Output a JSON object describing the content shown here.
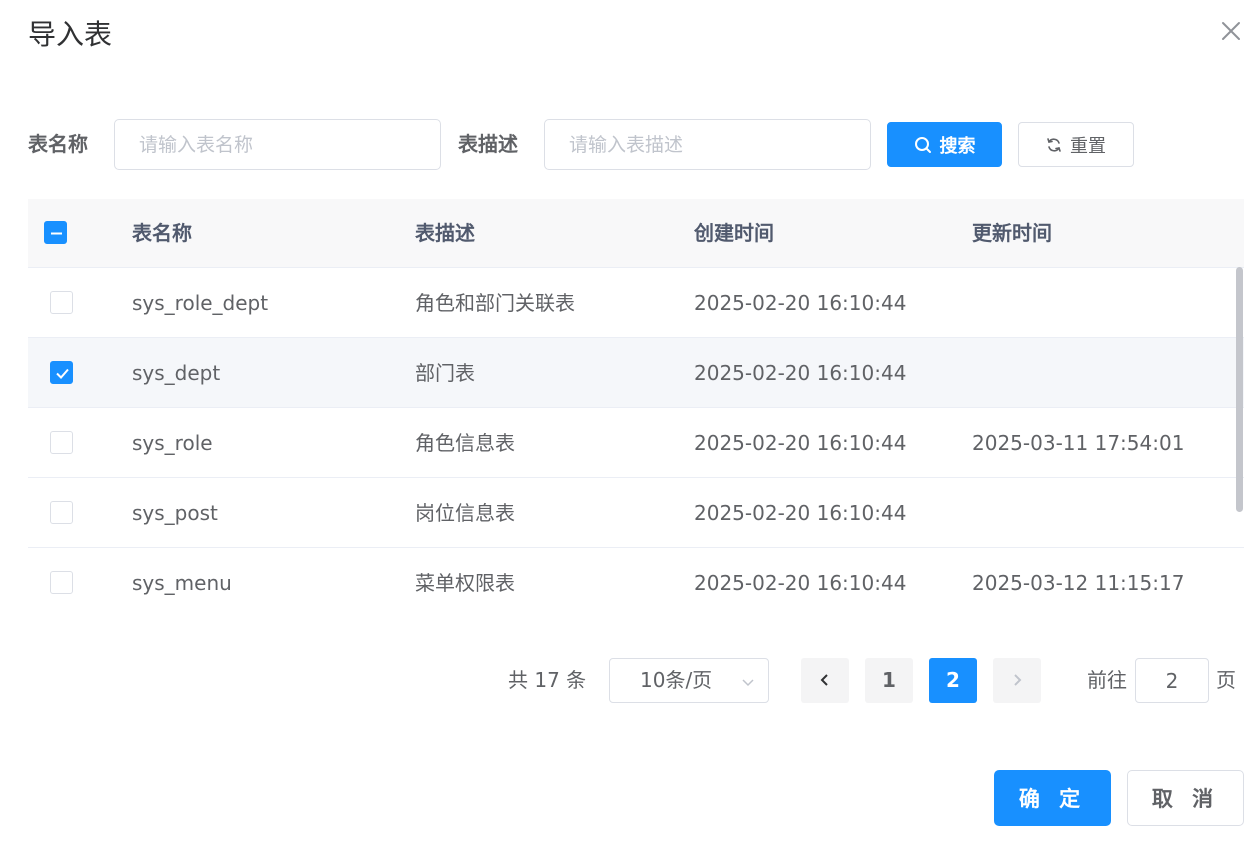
{
  "dialog": {
    "title": "导入表"
  },
  "search": {
    "table_name_label": "表名称",
    "table_name_placeholder": "请输入表名称",
    "table_desc_label": "表描述",
    "table_desc_placeholder": "请输入表描述",
    "search_label": "搜索",
    "reset_label": "重置"
  },
  "table": {
    "header_checkbox_state": "indeterminate",
    "columns": [
      "表名称",
      "表描述",
      "创建时间",
      "更新时间"
    ],
    "rows": [
      {
        "checked": false,
        "name": "sys_role_dept",
        "desc": "角色和部门关联表",
        "created": "2025-02-20 16:10:44",
        "updated": ""
      },
      {
        "checked": true,
        "name": "sys_dept",
        "desc": "部门表",
        "created": "2025-02-20 16:10:44",
        "updated": ""
      },
      {
        "checked": false,
        "name": "sys_role",
        "desc": "角色信息表",
        "created": "2025-02-20 16:10:44",
        "updated": "2025-03-11 17:54:01"
      },
      {
        "checked": false,
        "name": "sys_post",
        "desc": "岗位信息表",
        "created": "2025-02-20 16:10:44",
        "updated": ""
      },
      {
        "checked": false,
        "name": "sys_menu",
        "desc": "菜单权限表",
        "created": "2025-02-20 16:10:44",
        "updated": "2025-03-12 11:15:17"
      }
    ]
  },
  "pagination": {
    "total_text": "共 17 条",
    "page_size": "10条/页",
    "pages": [
      "1",
      "2"
    ],
    "current_page": "2",
    "goto_prefix": "前往",
    "goto_value": "2",
    "goto_suffix": "页"
  },
  "footer": {
    "confirm_label": "确 定",
    "cancel_label": "取 消"
  },
  "colors": {
    "primary": "#1890ff",
    "header_bg": "#f8f8f9",
    "selected_row_bg": "#f5f7fa"
  },
  "icons": [
    "close-icon",
    "search-icon",
    "refresh-icon",
    "chevron-down-icon",
    "chevron-left-icon",
    "chevron-right-icon",
    "check-icon",
    "minus-icon"
  ]
}
